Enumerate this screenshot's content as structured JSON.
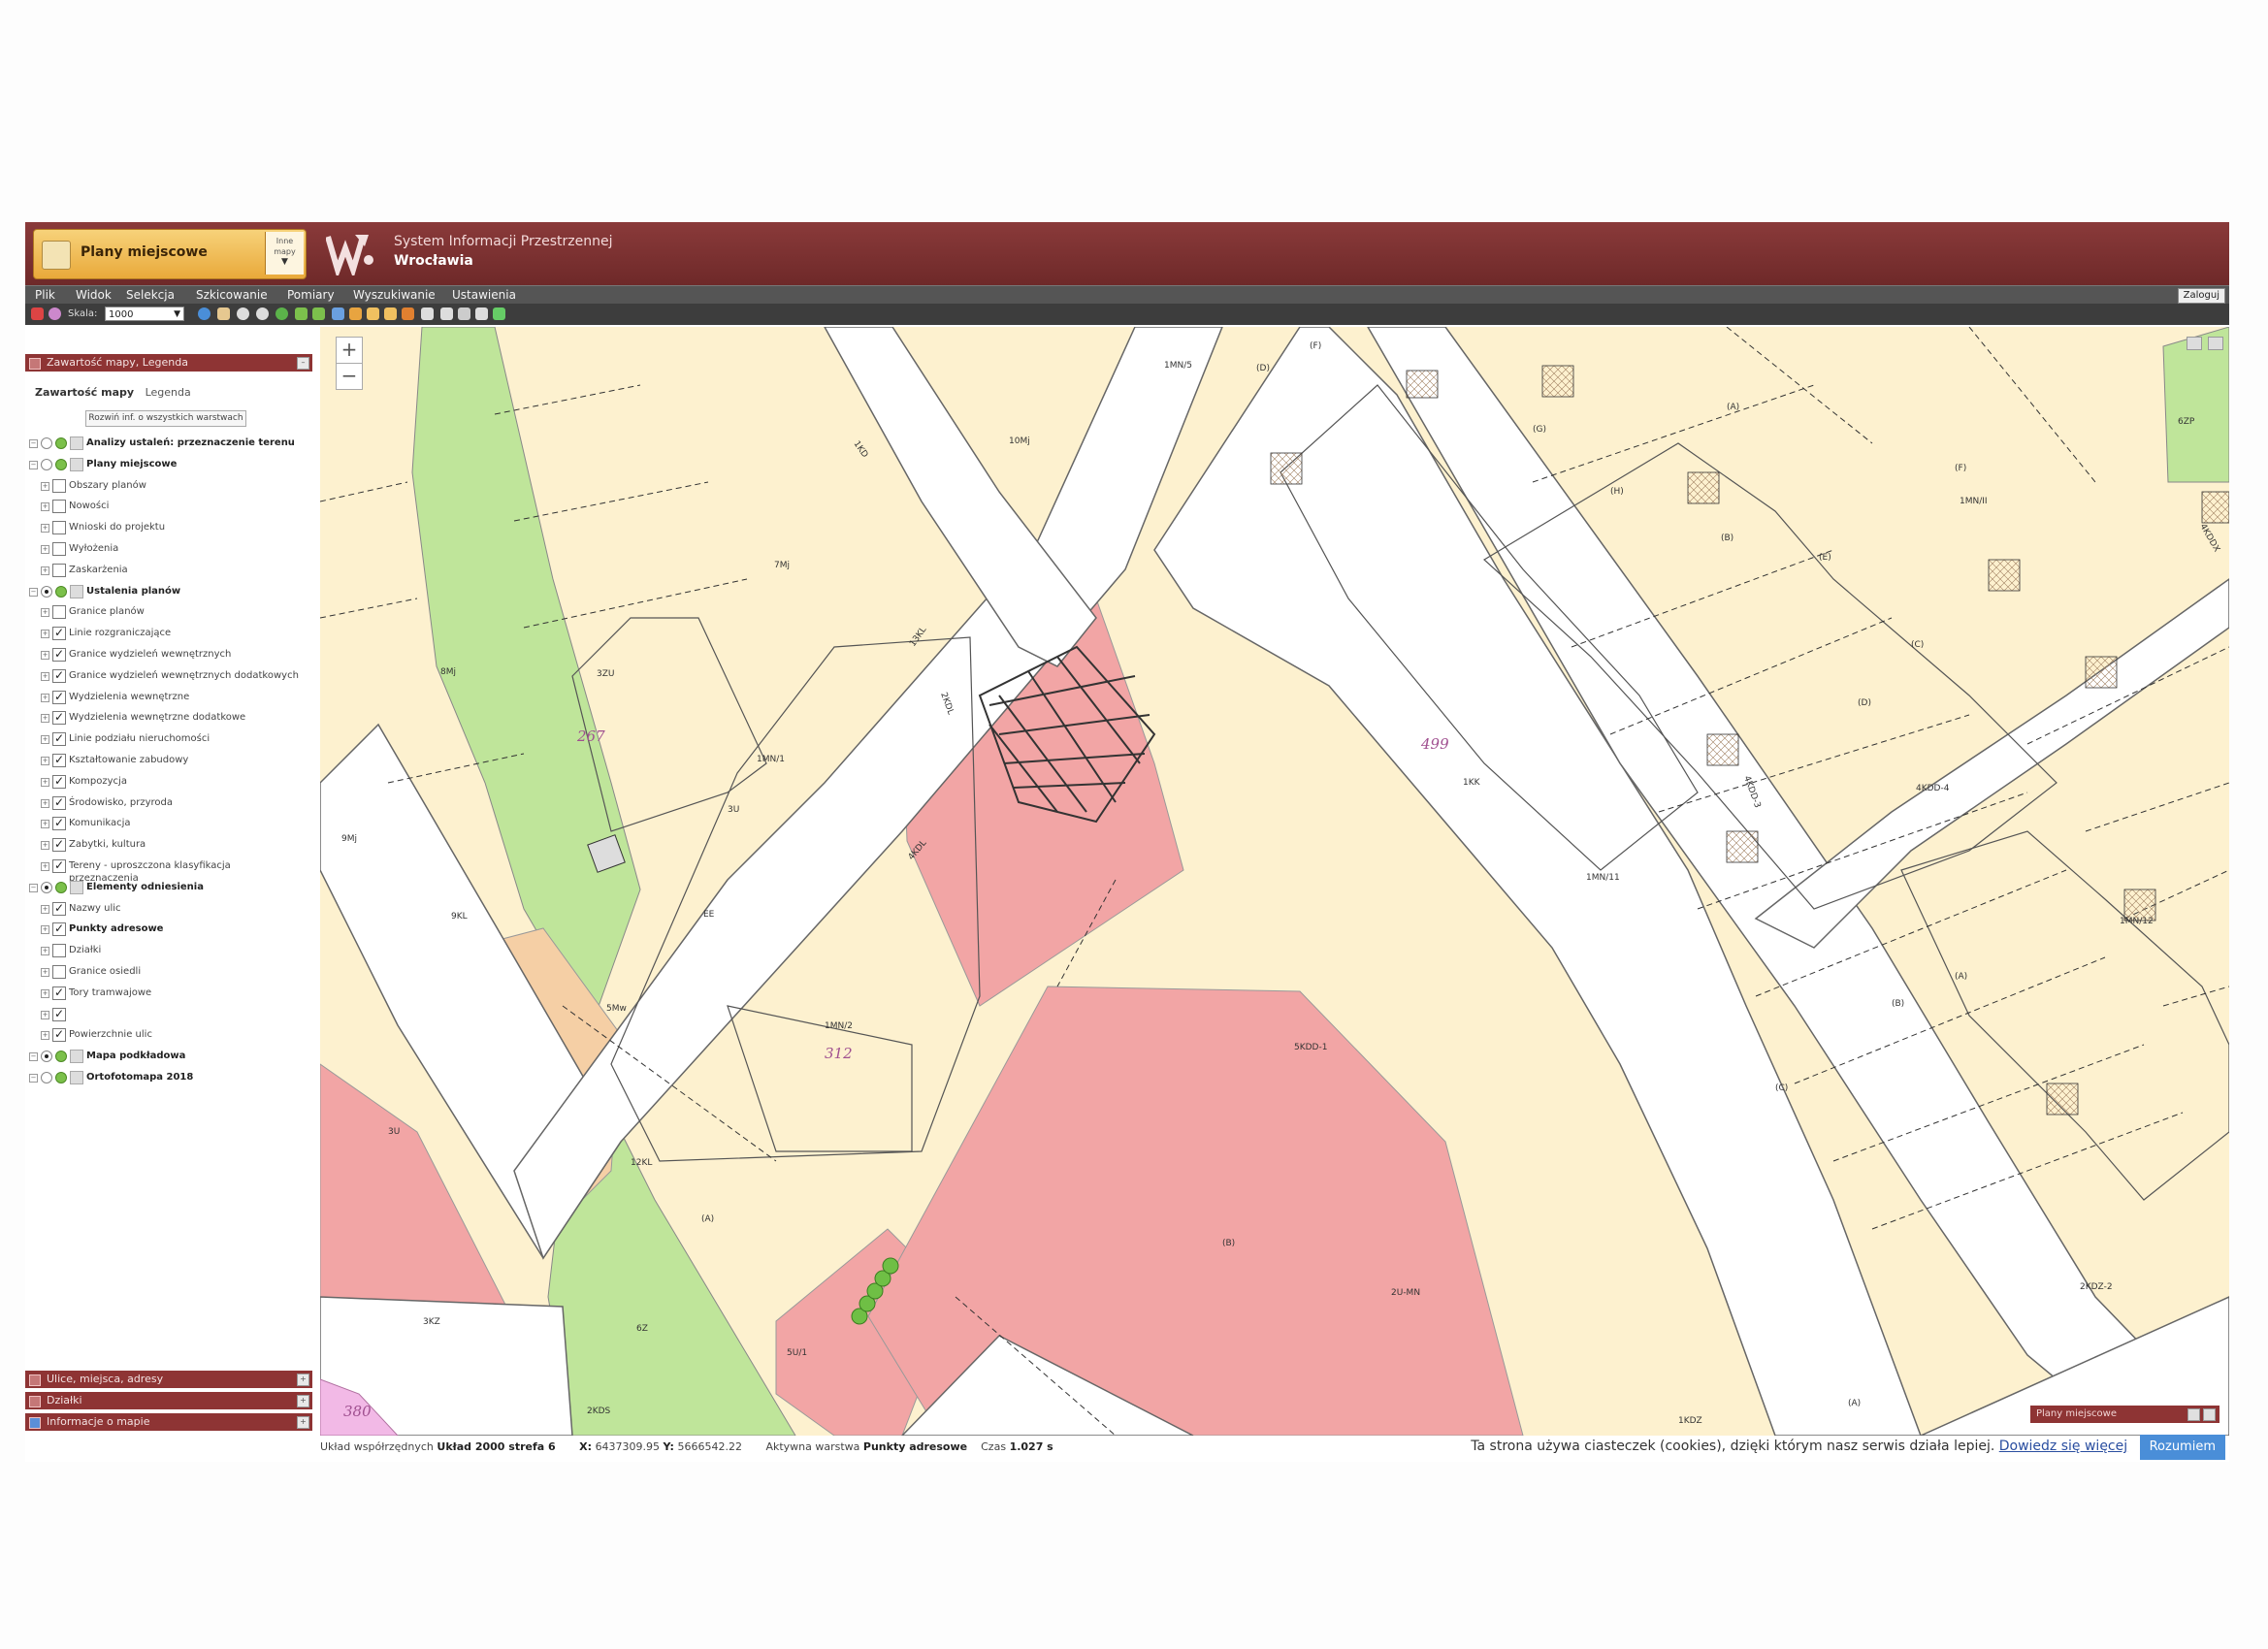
{
  "header": {
    "map_switch_label": "Plany miejscowe",
    "other_maps_label": "Inne mapy",
    "system_title": "System Informacji Przestrzennej",
    "system_city": "Wrocławia"
  },
  "menu": {
    "items": [
      "Plik",
      "Widok",
      "Selekcja",
      "Szkicowanie",
      "Pomiary",
      "Wyszukiwanie",
      "Ustawienia"
    ],
    "login_label": "Zaloguj"
  },
  "toolbar": {
    "scale_label": "Skala:",
    "scale_value": "1000"
  },
  "panel": {
    "title": "Zawartość mapy, Legenda",
    "tab_content": "Zawartość mapy",
    "tab_legend": "Legenda",
    "expand_button": "Rozwiń inf. o wszystkich warstwach",
    "layers": [
      {
        "label": "Analizy ustaleń: przeznaczenie terenu",
        "level": 0,
        "bold": true,
        "checked": false
      },
      {
        "label": "Plany miejscowe",
        "level": 0,
        "bold": true,
        "checked": false
      },
      {
        "label": "Obszary planów",
        "level": 1,
        "checked": false
      },
      {
        "label": "Nowości",
        "level": 1,
        "checked": false
      },
      {
        "label": "Wnioski do projektu",
        "level": 1,
        "checked": false
      },
      {
        "label": "Wyłożenia",
        "level": 1,
        "checked": false
      },
      {
        "label": "Zaskarżenia",
        "level": 1,
        "checked": false
      },
      {
        "label": "Ustalenia planów",
        "level": 0,
        "bold": true,
        "checked": true
      },
      {
        "label": "Granice planów",
        "level": 1,
        "checked": false
      },
      {
        "label": "Linie rozgraniczające",
        "level": 1,
        "checked": true
      },
      {
        "label": "Granice wydzieleń wewnętrznych",
        "level": 1,
        "checked": true
      },
      {
        "label": "Granice wydzieleń wewnętrznych dodatkowych",
        "level": 1,
        "checked": true
      },
      {
        "label": "Wydzielenia wewnętrzne",
        "level": 1,
        "checked": true
      },
      {
        "label": "Wydzielenia wewnętrzne dodatkowe",
        "level": 1,
        "checked": true
      },
      {
        "label": "Linie podziału nieruchomości",
        "level": 1,
        "checked": true
      },
      {
        "label": "Kształtowanie zabudowy",
        "level": 1,
        "checked": true
      },
      {
        "label": "Kompozycja",
        "level": 1,
        "checked": true
      },
      {
        "label": "Środowisko, przyroda",
        "level": 1,
        "checked": true
      },
      {
        "label": "Komunikacja",
        "level": 1,
        "checked": true
      },
      {
        "label": "Zabytki, kultura",
        "level": 1,
        "checked": true
      },
      {
        "label": "Tereny - uproszczona klasyfikacja",
        "label2": "przeznaczenia",
        "level": 1,
        "checked": true
      },
      {
        "label": "Elementy odniesienia",
        "level": 0,
        "bold": true,
        "checked": true
      },
      {
        "label": "Nazwy ulic",
        "level": 1,
        "checked": true
      },
      {
        "label": "Punkty adresowe",
        "level": 1,
        "bold": true,
        "checked": true
      },
      {
        "label": "Działki",
        "level": 1,
        "checked": false
      },
      {
        "label": "Granice osiedli",
        "level": 1,
        "checked": false
      },
      {
        "label": "Tory tramwajowe",
        "level": 1,
        "checked": true
      },
      {
        "label": "",
        "level": 1,
        "checked": true
      },
      {
        "label": "Powierzchnie ulic",
        "level": 1,
        "checked": true
      },
      {
        "label": "Mapa podkładowa",
        "level": 0,
        "bold": true,
        "checked": true
      },
      {
        "label": "Ortofotomapa 2018",
        "level": 0,
        "bold": true,
        "checked": false
      }
    ]
  },
  "bottom_panels": [
    "Ulice, miejsca, adresy",
    "Działki",
    "Informacje o mapie"
  ],
  "map": {
    "labels": [
      "1MN/5",
      "(D)",
      "(F)",
      "(A)",
      "(G)",
      "(H)",
      "(B)",
      "(E)",
      "(C)",
      "(D)",
      "(F)",
      "1MN/II",
      "6ZP",
      "4KDDX",
      "10Mj",
      "7Mj",
      "1KD",
      "13KL",
      "2KDL",
      "8Mj",
      "3ZU",
      "267",
      "9Mj",
      "1MN/1",
      "4KDL",
      "EE",
      "3U",
      "499",
      "1KK",
      "1MN/11",
      "4KDD-4",
      "4KDD-3",
      "1MN/12",
      "(A)",
      "(B)",
      "(C)",
      "9KL",
      "5Mw",
      "3U",
      "1MN/2",
      "312",
      "5KDD-1",
      "12KL",
      "(A)",
      "3KZ",
      "6Z",
      "5U/1",
      "2U-MN",
      "(B)",
      "2KDS",
      "1KDZ",
      "2KDZ-2",
      "(A)",
      "380"
    ],
    "mini_panel_title": "Plany miejscowe"
  },
  "status": {
    "coord_label": "Układ współrzędnych",
    "coord_system": "Układ 2000 strefa 6",
    "x_label": "X:",
    "x_value": "6437309.95",
    "y_label": "Y:",
    "y_value": "5666542.22",
    "active_label": "Aktywna warstwa",
    "active_value": "Punkty adresowe",
    "time_label": "Czas",
    "time_value": "1.027 s",
    "cookie_text": "Ta strona używa ciasteczek (cookies), dzięki którym nasz serwis działa lepiej.",
    "cookie_link": "Dowiedz się więcej",
    "cookie_button": "Rozumiem"
  },
  "colors": {
    "header": "#7a2f2f",
    "menubar": "#555555",
    "panel_header": "#8e3434",
    "map_yellow": "#fdf1cf",
    "map_red": "#f2a5a5",
    "map_green": "#bfe59a",
    "map_orange": "#f5cfa5"
  }
}
